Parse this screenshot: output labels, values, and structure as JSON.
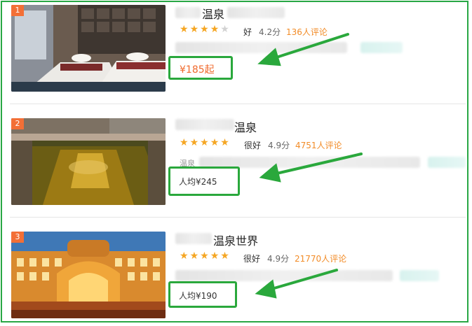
{
  "colors": {
    "highlight": "#2aa83c",
    "star": "#f5a623",
    "rank": "#f36f36",
    "review": "#f28c28",
    "price": "#f06a2d"
  },
  "listings": [
    {
      "rank": "1",
      "title": "温泉",
      "stars_filled": 4,
      "rating_word": "好",
      "score": "4.2分",
      "reviews": "136人评论",
      "subline": "",
      "price": "¥185起"
    },
    {
      "rank": "2",
      "title": "温泉",
      "stars_filled": 5,
      "rating_word": "很好",
      "score": "4.9分",
      "reviews": "4751人评论",
      "subline": "温泉",
      "price": "人均¥245"
    },
    {
      "rank": "3",
      "title": "温泉世界",
      "stars_filled": 5,
      "rating_word": "很好",
      "score": "4.9分",
      "reviews": "21770人评论",
      "subline": "",
      "price": "人均¥190"
    }
  ]
}
